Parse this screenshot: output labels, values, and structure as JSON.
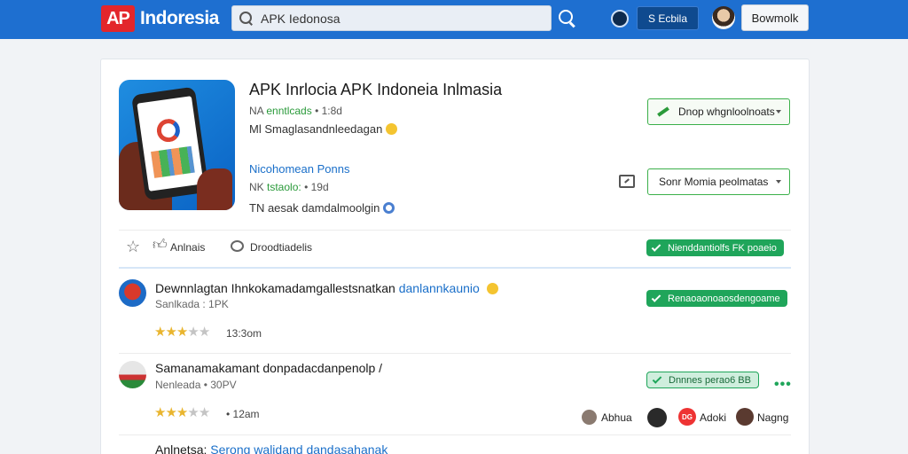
{
  "header": {
    "logo_mark": "AP",
    "logo_text": "Indoresia",
    "search_placeholder": "APK Iedonosa",
    "sign_label": "S Ecbila",
    "bookmark_label": "Bowmolk"
  },
  "app": {
    "title": "APK Inrlocia APK Indoneia Inlmasia",
    "meta1_a": "NA",
    "meta1_b": "enntlcads",
    "meta1_c": "• 1:8d",
    "meta2": "Ml Smaglasandnleedagan",
    "developer": "Nicohomean Ponns",
    "meta3_a": "NK",
    "meta3_b": "tstaolo:",
    "meta3_c": "• 19d",
    "meta4": "TN aesak damdalmoolgin",
    "download_label": "Dnop whgnloolnoats",
    "select_label": "Sonr Momia peolmatas"
  },
  "actions": {
    "like_label": "Anlnais",
    "comment_label": "Droodtiadelis",
    "badge": "Nienddantiolfs FK poaeio"
  },
  "comments": [
    {
      "text": "Dewnnlagtan Ihnkokamadamgallestsnatkan",
      "link": "danlannkaunio",
      "sub": "Sanlkada : 1PK",
      "rating": 3,
      "rating_text": "13:3om",
      "badge": "Renaoaonoaosdengoame"
    },
    {
      "text": "Samanamakamant donpadacdanpenolp /",
      "sub": "Nenleada • 30PV",
      "rating": 3,
      "rating_text": "• 12am",
      "badge": "Dnnnes perao6  BB"
    }
  ],
  "reactors": [
    {
      "label": "Abhua"
    },
    {
      "label": ""
    },
    {
      "label": "Adoki",
      "initials": "DG"
    },
    {
      "label": "Nagng"
    }
  ],
  "third_comment": {
    "text": "Anlnetsa:",
    "link": "Serong walidand dandasahanak"
  },
  "colors": {
    "brand_blue": "#1e6fd0",
    "accent_green": "#1fa55a",
    "logo_red": "#e3262b",
    "link_blue": "#1a6fc9"
  }
}
